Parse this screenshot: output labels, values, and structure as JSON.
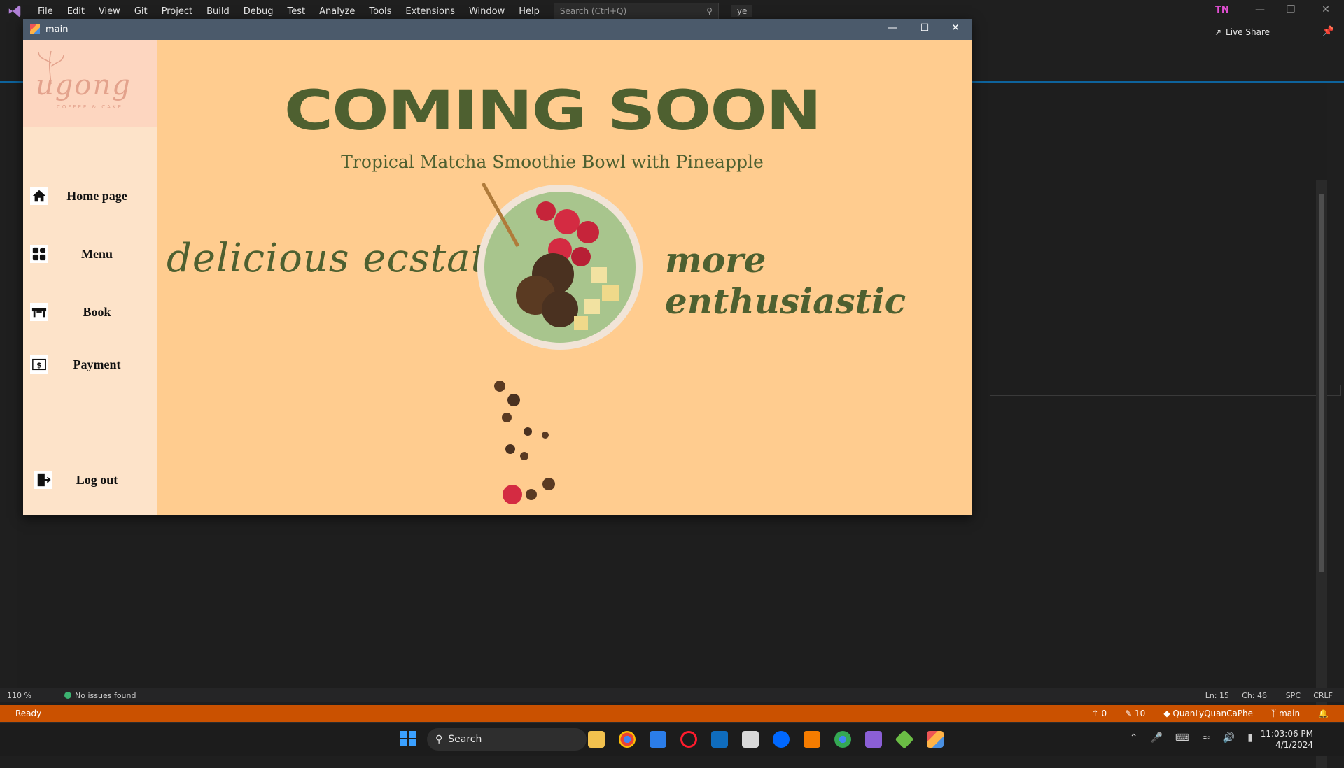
{
  "vs": {
    "menu": [
      "File",
      "Edit",
      "View",
      "Git",
      "Project",
      "Build",
      "Debug",
      "Test",
      "Analyze",
      "Tools",
      "Extensions",
      "Window",
      "Help"
    ],
    "search_placeholder": "Search (Ctrl+Q)",
    "solution_name": "ye",
    "user_initials": "TN",
    "live_share": "Live Share",
    "zoom": "110 %",
    "issues": "No issues found",
    "ln": "Ln: 15",
    "ch": "Ch: 46",
    "spc": "SPC",
    "crlf": "CRLF",
    "status": "Ready",
    "up_count": "0",
    "edit_count": "10",
    "repo": "QuanLyQuanCaPhe",
    "branch": "main"
  },
  "taskbar": {
    "search": "Search",
    "time": "11:03:06 PM",
    "date": "4/1/2024",
    "colors": {
      "start": "#3aa0ff"
    }
  },
  "app": {
    "title": "main",
    "logo_text": "ugong",
    "logo_sub": "COFFEE & CAKE",
    "nav": {
      "home": "Home page",
      "menu": "Menu",
      "book": "Book",
      "payment": "Payment",
      "logout": "Log out"
    },
    "headline": "COMING SOON",
    "subtitle": "Tropical Matcha Smoothie Bowl with Pineapple",
    "tag_left": "delicious ecstatic",
    "tag_right": "more enthusiastic",
    "colors": {
      "background": "#ffcc8f",
      "sidebar": "#fde3c9",
      "accent": "#4e6030"
    }
  }
}
